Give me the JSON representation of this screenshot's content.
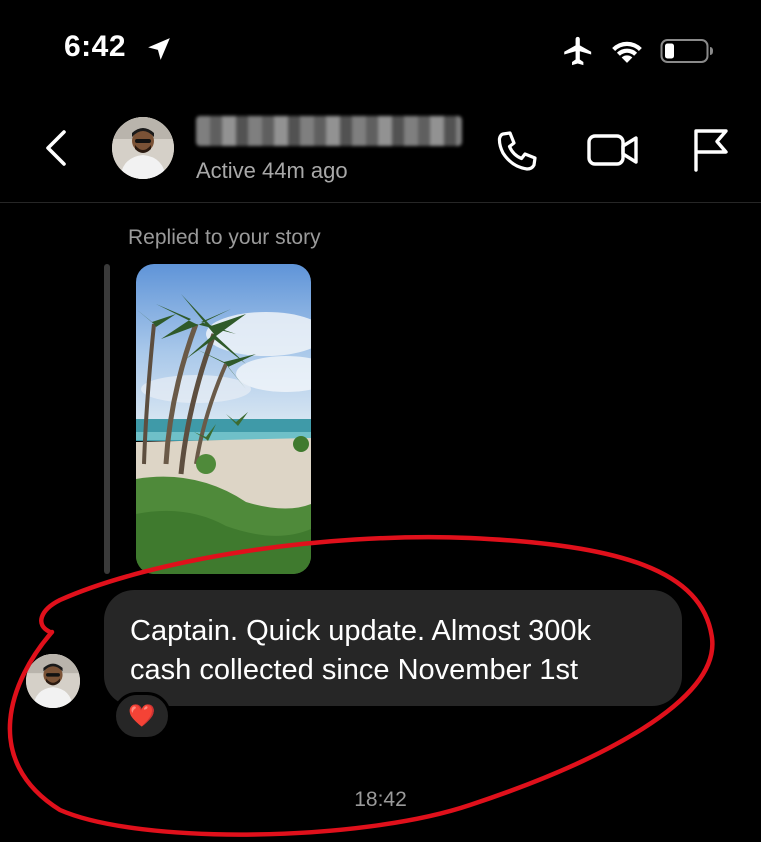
{
  "status_bar": {
    "time": "6:42",
    "icons": [
      "location-arrow-icon",
      "airplane-icon",
      "wifi-icon",
      "battery-icon"
    ]
  },
  "header": {
    "contact_status": "Active 44m ago",
    "actions": [
      "back-icon",
      "phone-icon",
      "video-call-icon",
      "flag-icon"
    ]
  },
  "story_reply": {
    "label": "Replied to your story"
  },
  "message": {
    "line1": "Captain. Quick update. Almost 300k",
    "line2": "cash collected since November 1st",
    "reaction": "❤️"
  },
  "timestamp": "18:42",
  "colors": {
    "background": "#000000",
    "bubble": "#262626",
    "secondary_text": "#a8a8a8",
    "annotation": "#e0101b"
  }
}
